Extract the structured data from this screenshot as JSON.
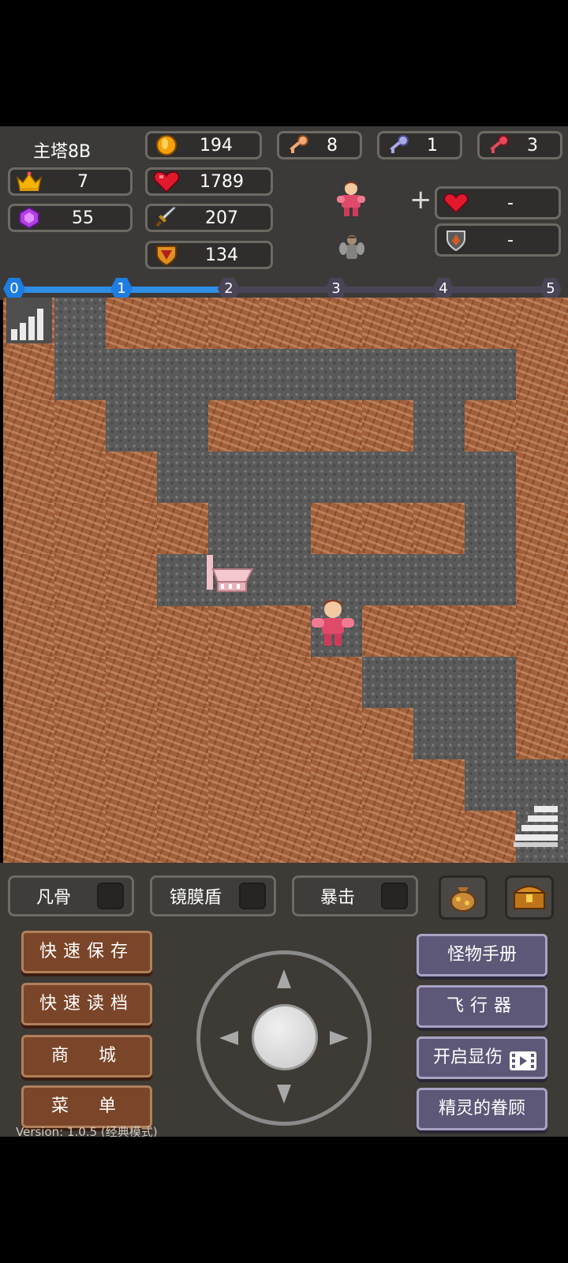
{
  "hud": {
    "floor_title": "主塔8B",
    "level": "7",
    "gems": "55",
    "gold": "194",
    "hp": "1789",
    "attack": "207",
    "defense": "134",
    "yellow_keys": "8",
    "blue_keys": "1",
    "red_keys": "3",
    "plus": "+",
    "bonus_hp": "-",
    "bonus_def": "-"
  },
  "progress": {
    "nodes": [
      "0",
      "1",
      "2",
      "3",
      "4",
      "5"
    ],
    "current_index": 1,
    "active_color": "#2f8de4",
    "inactive_color": "#4a4456"
  },
  "skills": [
    {
      "label": "凡骨"
    },
    {
      "label": "镜膜盾"
    },
    {
      "label": "暴击"
    }
  ],
  "left_buttons": [
    "快速保存",
    "快速读档",
    "商　城",
    "菜　单"
  ],
  "right_buttons": [
    "怪物手册",
    "飞行器",
    "开启显伤",
    "精灵的眷顾"
  ],
  "icons": {
    "bag": "bag-icon",
    "chest": "treasure-chest-icon"
  },
  "version": "Version: 1.0.5 (经典模式)"
}
